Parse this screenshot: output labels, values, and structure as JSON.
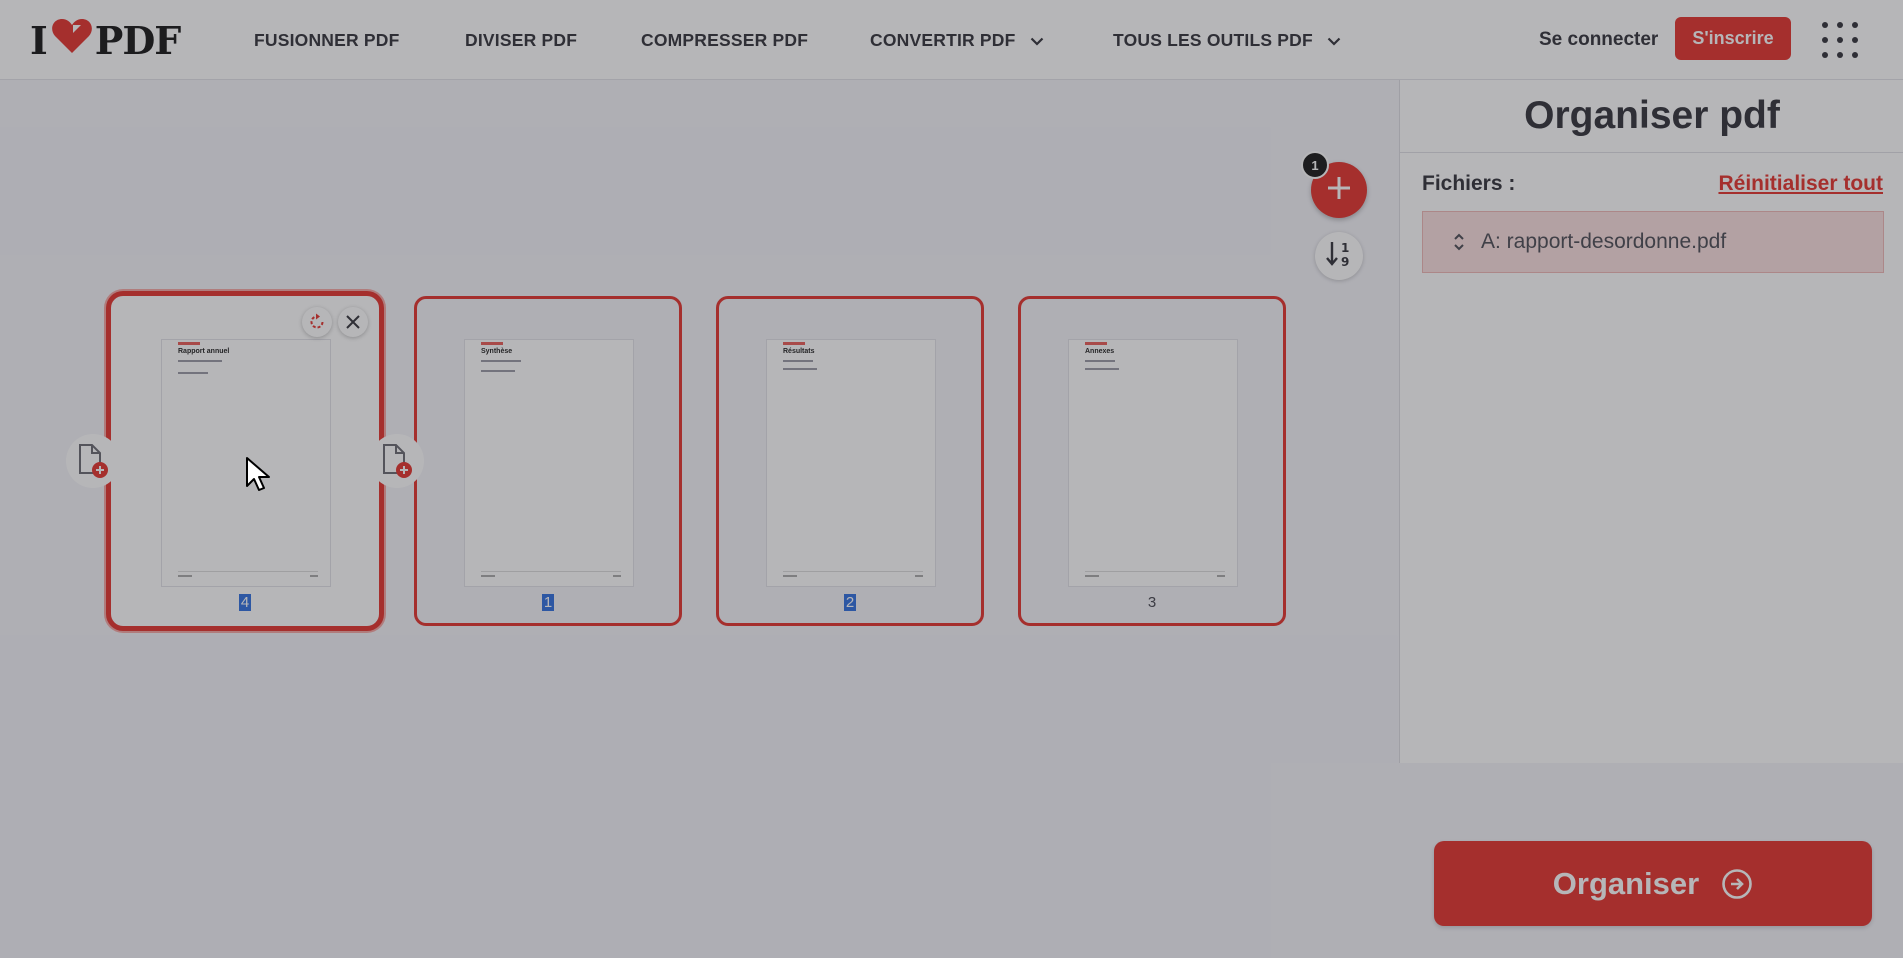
{
  "header": {
    "logo_left": "I",
    "logo_right": "PDF",
    "nav": {
      "merge": "FUSIONNER PDF",
      "split": "DIVISER PDF",
      "compress": "COMPRESSER PDF",
      "convert": "CONVERTIR PDF",
      "all_tools": "TOUS LES OUTILS PDF"
    },
    "login": "Se connecter",
    "signup": "S'inscrire"
  },
  "workspace": {
    "file_count_badge": "1",
    "pages": [
      {
        "number": "4",
        "title": "Rapport annuel",
        "selected": true,
        "number_highlighted": true
      },
      {
        "number": "1",
        "title": "Synthèse",
        "selected": false,
        "number_highlighted": true
      },
      {
        "number": "2",
        "title": "Résultats",
        "selected": false,
        "number_highlighted": true
      },
      {
        "number": "3",
        "title": "Annexes",
        "selected": false,
        "number_highlighted": false
      }
    ]
  },
  "sidebar": {
    "title": "Organiser pdf",
    "files_label": "Fichiers :",
    "reset_label": "Réinitialiser tout",
    "file_name": "A: rapport-desordonne.pdf",
    "organize_label": "Organiser"
  },
  "colors": {
    "brand": "#e5322d",
    "text": "#33333b",
    "workspace_bg": "#f4f4f9",
    "selection": "#2f6fdf"
  },
  "icons": {
    "logo": "heart-icon",
    "convert_menu": "chevron-down-icon",
    "all_tools_menu": "chevron-down-icon",
    "apps": "grid-dots-icon",
    "add_file": "plus-icon",
    "sort": "sort-numeric-icon",
    "rotate": "rotate-icon",
    "delete": "close-icon",
    "insert_page": "file-add-icon",
    "drag": "drag-handle-icon",
    "organize": "arrow-circle-right-icon"
  }
}
